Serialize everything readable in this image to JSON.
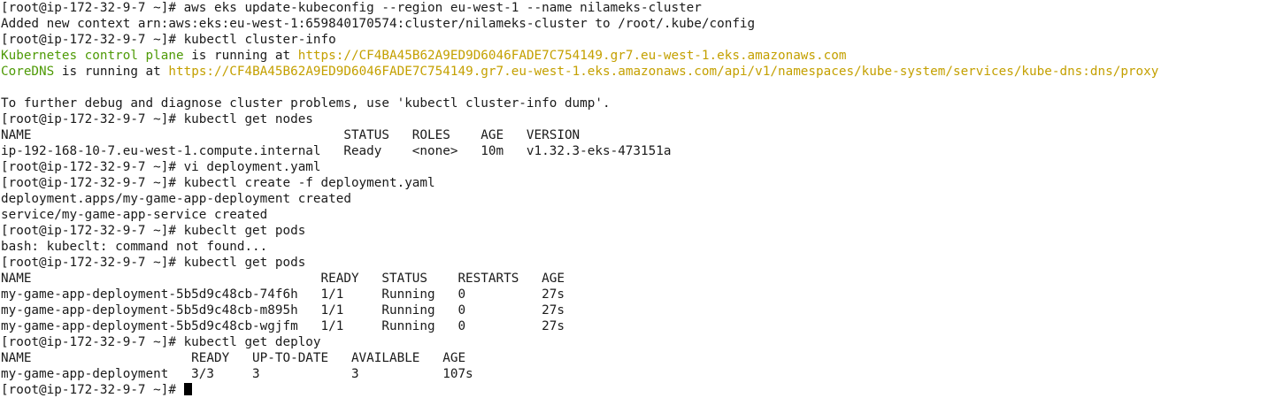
{
  "terminal": {
    "lines": [
      [
        {
          "t": "[root@ip-172-32-9-7 ~]# aws eks update-kubeconfig --region eu-west-1 --name nilameks-cluster"
        }
      ],
      [
        {
          "t": "Added new context arn:aws:eks:eu-west-1:659840170574:cluster/nilameks-cluster to /root/.kube/config"
        }
      ],
      [
        {
          "t": "[root@ip-172-32-9-7 ~]# kubectl cluster-info"
        }
      ],
      [
        {
          "t": "Kubernetes control plane",
          "c": "green"
        },
        {
          "t": " is running at "
        },
        {
          "t": "https://CF4BA45B62A9ED9D6046FADE7C754149.gr7.eu-west-1.eks.amazonaws.com",
          "c": "yellow"
        }
      ],
      [
        {
          "t": "CoreDNS",
          "c": "green"
        },
        {
          "t": " is running at "
        },
        {
          "t": "https://CF4BA45B62A9ED9D6046FADE7C754149.gr7.eu-west-1.eks.amazonaws.com/api/v1/namespaces/kube-system/services/kube-dns:dns/proxy",
          "c": "yellow"
        }
      ],
      [
        {
          "t": ""
        }
      ],
      [
        {
          "t": "To further debug and diagnose cluster problems, use 'kubectl cluster-info dump'."
        }
      ],
      [
        {
          "t": "[root@ip-172-32-9-7 ~]# kubectl get nodes"
        }
      ],
      [
        {
          "t": "NAME                                         STATUS   ROLES    AGE   VERSION"
        }
      ],
      [
        {
          "t": "ip-192-168-10-7.eu-west-1.compute.internal   Ready    <none>   10m   v1.32.3-eks-473151a"
        }
      ],
      [
        {
          "t": "[root@ip-172-32-9-7 ~]# vi deployment.yaml"
        }
      ],
      [
        {
          "t": "[root@ip-172-32-9-7 ~]# kubectl create -f deployment.yaml"
        }
      ],
      [
        {
          "t": "deployment.apps/my-game-app-deployment created"
        }
      ],
      [
        {
          "t": "service/my-game-app-service created"
        }
      ],
      [
        {
          "t": "[root@ip-172-32-9-7 ~]# kubeclt get pods"
        }
      ],
      [
        {
          "t": "bash: kubeclt: command not found..."
        }
      ],
      [
        {
          "t": "[root@ip-172-32-9-7 ~]# kubectl get pods"
        }
      ],
      [
        {
          "t": "NAME                                      READY   STATUS    RESTARTS   AGE"
        }
      ],
      [
        {
          "t": "my-game-app-deployment-5b5d9c48cb-74f6h   1/1     Running   0          27s"
        }
      ],
      [
        {
          "t": "my-game-app-deployment-5b5d9c48cb-m895h   1/1     Running   0          27s"
        }
      ],
      [
        {
          "t": "my-game-app-deployment-5b5d9c48cb-wgjfm   1/1     Running   0          27s"
        }
      ],
      [
        {
          "t": "[root@ip-172-32-9-7 ~]# kubectl get deploy"
        }
      ],
      [
        {
          "t": "NAME                     READY   UP-TO-DATE   AVAILABLE   AGE"
        }
      ],
      [
        {
          "t": "my-game-app-deployment   3/3     3            3           107s"
        }
      ]
    ],
    "prompt": "[root@ip-172-32-9-7 ~]# ",
    "input_value": ""
  }
}
